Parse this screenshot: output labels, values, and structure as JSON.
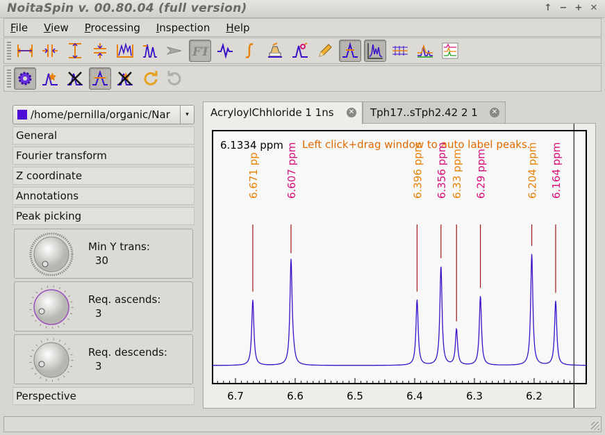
{
  "window": {
    "title": "NoitaSpin v. 00.80.04 (full version)",
    "controls": [
      "↑",
      "−",
      "+",
      "✕"
    ]
  },
  "menu": [
    {
      "underline": "F",
      "rest": "ile"
    },
    {
      "underline": "V",
      "rest": "iew"
    },
    {
      "underline": "P",
      "rest": "rocessing"
    },
    {
      "underline": "I",
      "rest": "nspection"
    },
    {
      "underline": "H",
      "rest": "elp"
    }
  ],
  "left_panel": {
    "file_path": "/home/pernilla/organic/Nar",
    "file_color": "#4b0ad6",
    "sections": {
      "general": "General",
      "fourier": "Fourier transform",
      "zcoord": "Z coordinate",
      "annotations": "Annotations",
      "peak_picking": "Peak picking",
      "perspective": "Perspective"
    },
    "min_y_trans": {
      "label": "Min Y trans:",
      "value": "30"
    },
    "req_ascends": {
      "label": "Req. ascends:",
      "value": "3"
    },
    "req_descends": {
      "label": "Req. descends:",
      "value": "3"
    }
  },
  "tabs": [
    {
      "label": "AcryloylChhloride 1 1ns",
      "active": true
    },
    {
      "label": "Tph17..sTph2.42 2 1",
      "active": false
    }
  ],
  "spectrum": {
    "cursor_readout": "6.1334 ppm",
    "hint": "Left click+drag window to auto label peaks.",
    "hint_color": "#e06a00",
    "line_color": "#3a10c8",
    "marker_color": "#a01818",
    "colors": {
      "orange": "#e8820a",
      "magenta": "#d8107a"
    },
    "ppm_min": 6.1,
    "ppm_max": 6.74,
    "cursor_ppm": 6.1334,
    "peaks": [
      {
        "ppm": 6.671,
        "label": "6.671 pp",
        "height": 0.53,
        "color": "orange"
      },
      {
        "ppm": 6.607,
        "label": "6.607 ppm",
        "height": 0.84,
        "color": "magenta"
      },
      {
        "ppm": 6.396,
        "label": "6.396 ppm",
        "height": 0.53,
        "color": "orange"
      },
      {
        "ppm": 6.356,
        "label": "6.356 ppm",
        "height": 0.8,
        "color": "magenta"
      },
      {
        "ppm": 6.33,
        "label": "6.33 ppm",
        "height": 0.29,
        "color": "orange"
      },
      {
        "ppm": 6.29,
        "label": "6.29 ppm",
        "height": 0.56,
        "color": "magenta"
      },
      {
        "ppm": 6.204,
        "label": "6.204 ppm",
        "height": 0.9,
        "color": "orange"
      },
      {
        "ppm": 6.164,
        "label": "6.164 ppm",
        "height": 0.52,
        "color": "magenta"
      }
    ],
    "x_ticks": [
      "6.7",
      "6.6",
      "6.5",
      "6.4",
      "6.3",
      "6.2"
    ]
  }
}
